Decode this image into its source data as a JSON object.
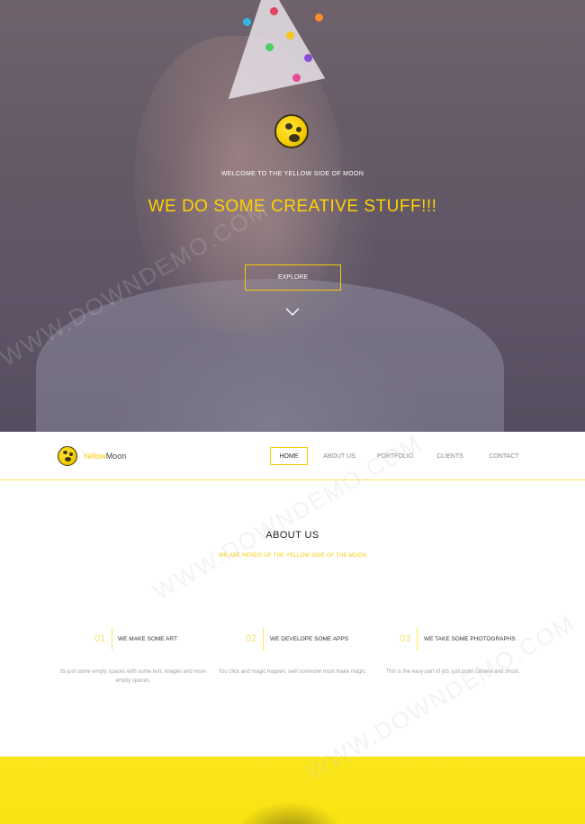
{
  "hero": {
    "welcome_text": "WELCOME TO THE YELLOW SIDE OF MOON",
    "headline": "WE DO SOME CREATIVE STUFF!!!",
    "explore_label": "EXPLORE",
    "chevron_icon": "chevron-down-icon",
    "logo_icon": "moon-logo-icon"
  },
  "nav": {
    "brand_yellow": "Yellow",
    "brand_dark": "Moon",
    "items": [
      {
        "label": "HOME",
        "active": true
      },
      {
        "label": "ABOUT US",
        "active": false
      },
      {
        "label": "PORTFOLIO",
        "active": false
      },
      {
        "label": "CLIENTS",
        "active": false
      },
      {
        "label": "CONTACT",
        "active": false
      }
    ]
  },
  "about": {
    "title": "ABOUT US",
    "subtitle": "WE ARE NERDS OF THE YELLOW SIDE OF THE MOON",
    "features": [
      {
        "number": "01",
        "title": "WE MAKE SOME ART",
        "description": "Its just some empty spaces with some text, images and more empty spaces."
      },
      {
        "number": "02",
        "title": "WE DEVELOPE SOME APPS",
        "description": "You click and magic happen, well someone must make magic."
      },
      {
        "number": "03",
        "title": "WE TAKE SOME PHOTOGRAPHS",
        "description": "This is the easy part of job, just point camera and shoot."
      }
    ]
  },
  "watermark": "WWW.DOWNDEMO.COM",
  "colors": {
    "accent": "#f5cc00",
    "band": "#fbe61c"
  }
}
